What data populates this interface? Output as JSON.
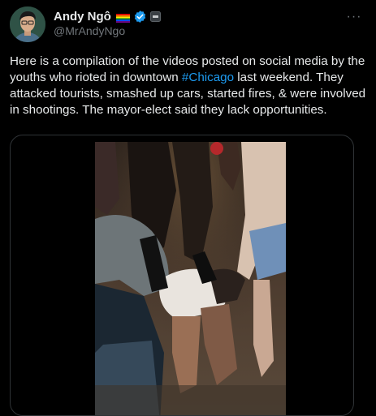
{
  "author": {
    "display_name": "Andy Ngô",
    "handle": "@MrAndyNgo",
    "flag_icon": "rainbow-flag-icon",
    "verified_icon": "verified-badge-icon",
    "affiliate_icon": "affiliate-badge-icon",
    "verified_color": "#1d9bf0"
  },
  "menu": {
    "more_label": "···"
  },
  "tweet": {
    "text_before": "Here is a compilation of the videos posted on social media by the youths who rioted in downtown ",
    "hashtag": "#Chicago",
    "text_after": " last weekend. They attacked tourists, smashed up cars, started fires, & were involved in shootings. The mayor-elect said they lack opportunities."
  },
  "media": {
    "type": "video",
    "icon": "video-thumbnail"
  },
  "colors": {
    "background": "#000000",
    "text": "#e7e9ea",
    "secondary": "#71767b",
    "link": "#1d9bf0",
    "border": "#2f3336"
  }
}
